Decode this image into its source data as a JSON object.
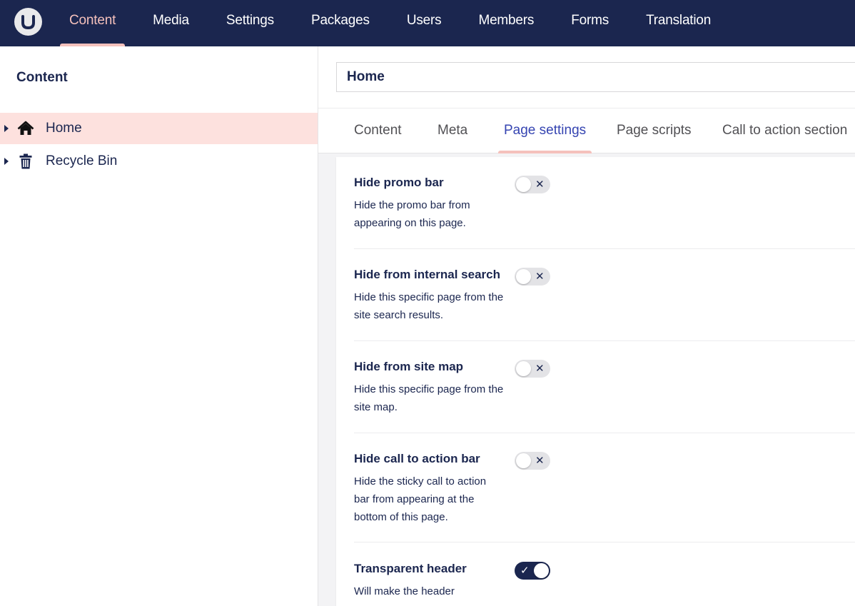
{
  "brand": {
    "logo_icon": "umbraco-logo-icon"
  },
  "nav": {
    "items": [
      {
        "label": "Content",
        "active": true
      },
      {
        "label": "Media"
      },
      {
        "label": "Settings"
      },
      {
        "label": "Packages"
      },
      {
        "label": "Users"
      },
      {
        "label": "Members"
      },
      {
        "label": "Forms"
      },
      {
        "label": "Translation"
      }
    ]
  },
  "sidebar": {
    "title": "Content",
    "items": [
      {
        "label": "Home",
        "icon": "home-icon",
        "active": true
      },
      {
        "label": "Recycle Bin",
        "icon": "trash-icon"
      }
    ]
  },
  "editor": {
    "node_name": "Home",
    "tabs": [
      {
        "label": "Content"
      },
      {
        "label": "Meta"
      },
      {
        "label": "Page settings",
        "active": true
      },
      {
        "label": "Page scripts"
      },
      {
        "label": "Call to action section"
      }
    ],
    "properties": [
      {
        "label": "Hide promo bar",
        "description": "Hide the promo bar from appearing on this page.",
        "enabled": false,
        "glyph": "✕"
      },
      {
        "label": "Hide from internal search",
        "description": "Hide this specific page from the site search results.",
        "enabled": false,
        "glyph": "✕"
      },
      {
        "label": "Hide from site map",
        "description": "Hide this specific page from the site map.",
        "enabled": false,
        "glyph": "✕"
      },
      {
        "label": "Hide call to action bar",
        "description": "Hide the sticky call to action bar from appearing at the bottom of this page.",
        "enabled": false,
        "glyph": "✕"
      },
      {
        "label": "Transparent header",
        "description": "Will make the header",
        "enabled": true,
        "glyph": "✓"
      }
    ]
  },
  "colors": {
    "topbar": "#1b264f",
    "accent": "#f5c1bc",
    "active_tab_text": "#3544b1",
    "active_tree_bg": "#fde1de"
  }
}
